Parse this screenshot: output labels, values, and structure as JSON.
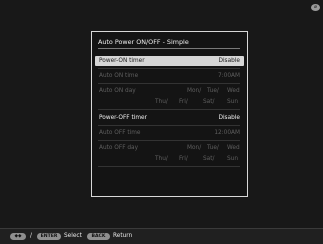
{
  "top_icon": "wifi-off-icon",
  "panel": {
    "title": "Auto Power ON/OFF - Simple",
    "rows": [
      {
        "label": "Power-ON timer",
        "value": "Disable"
      },
      {
        "label": "Auto ON time",
        "value": "7:00AM"
      },
      {
        "label": "Auto ON day"
      },
      {
        "label": "Power-OFF timer",
        "value": "Disable"
      },
      {
        "label": "Auto OFF time",
        "value": "12:00AM"
      },
      {
        "label": "Auto OFF day"
      }
    ],
    "days_line1": [
      "Mon/",
      "Tue/",
      "Wed"
    ],
    "days_line2": [
      "Thu/",
      "Fri/",
      "Sat/",
      "Sun"
    ]
  },
  "footer": {
    "nav_glyph": "◆◆",
    "slash": "/",
    "enter_key": "ENTER",
    "select_label": "Select",
    "back_key": "BACK",
    "return_label": "Return"
  }
}
